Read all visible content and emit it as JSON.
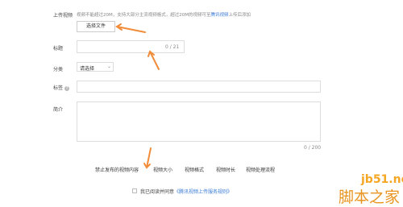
{
  "upload": {
    "label": "上传视频",
    "hint_prefix": "视频不能超过20M，支持大部分主流视频格式，超过20M的视频可至",
    "hint_link": "腾讯视频",
    "hint_suffix": "上传后添加",
    "choose_button": "选择文件"
  },
  "title_field": {
    "label": "标题",
    "counter": "0 / 21"
  },
  "category": {
    "label": "分类",
    "selected": "请选择"
  },
  "tags": {
    "label": "标签",
    "help_icon": "?"
  },
  "intro": {
    "label": "简介",
    "counter": "0 / 200"
  },
  "rules_tabs": [
    "禁止发布的视频内容",
    "视频大小",
    "视频格式",
    "视频时长",
    "视频处理流程"
  ],
  "agreement": {
    "prefix": "我已阅读并同意",
    "link": "《腾讯视频上传服务规则》"
  },
  "watermark": {
    "site": "jb51.net",
    "brand": "脚本之家"
  },
  "colors": {
    "accent": "#3a7bd5",
    "arrow": "#f08c3a"
  }
}
